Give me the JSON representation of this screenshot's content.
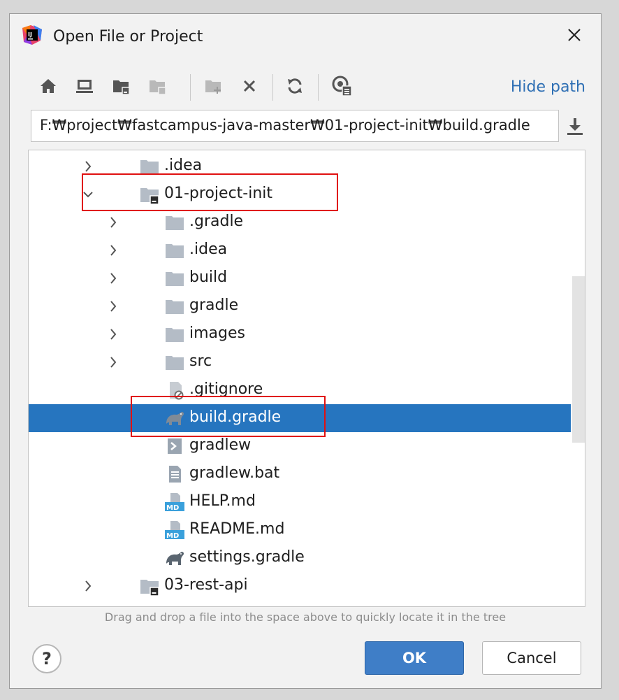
{
  "window": {
    "title": "Open File or Project"
  },
  "toolbar": {
    "buttons": [
      {
        "icon": "home-icon"
      },
      {
        "icon": "desktop-icon"
      },
      {
        "icon": "project-folder-icon"
      },
      {
        "icon": "module-folder-icon"
      },
      {
        "icon": "new-folder-icon"
      },
      {
        "icon": "delete-icon"
      },
      {
        "icon": "refresh-icon"
      },
      {
        "icon": "show-hidden-icon"
      }
    ],
    "hide_path_label": "Hide path"
  },
  "path": {
    "value": "F:₩project₩fastcampus-java-master₩01-project-init₩build.gradle"
  },
  "tree": {
    "items": [
      {
        "label": ".idea",
        "level": 0,
        "type": "folder",
        "expanded": false
      },
      {
        "label": "01-project-init",
        "level": 0,
        "type": "module-folder",
        "expanded": true
      },
      {
        "label": ".gradle",
        "level": 1,
        "type": "folder",
        "expanded": false
      },
      {
        "label": ".idea",
        "level": 1,
        "type": "folder",
        "expanded": false
      },
      {
        "label": "build",
        "level": 1,
        "type": "folder",
        "expanded": false
      },
      {
        "label": "gradle",
        "level": 1,
        "type": "folder",
        "expanded": false
      },
      {
        "label": "images",
        "level": 1,
        "type": "folder",
        "expanded": false
      },
      {
        "label": "src",
        "level": 1,
        "type": "folder",
        "expanded": false
      },
      {
        "label": ".gitignore",
        "level": 1,
        "type": "gitignore"
      },
      {
        "label": "build.gradle",
        "level": 1,
        "type": "gradle",
        "selected": true
      },
      {
        "label": "gradlew",
        "level": 1,
        "type": "script"
      },
      {
        "label": "gradlew.bat",
        "level": 1,
        "type": "text"
      },
      {
        "label": "HELP.md",
        "level": 1,
        "type": "md"
      },
      {
        "label": "README.md",
        "level": 1,
        "type": "md"
      },
      {
        "label": "settings.gradle",
        "level": 1,
        "type": "gradle"
      },
      {
        "label": "03-rest-api",
        "level": 0,
        "type": "module-folder",
        "expanded": false
      }
    ]
  },
  "hint": "Drag and drop a file into the space above to quickly locate it in the tree",
  "buttons": {
    "help": "?",
    "ok": "OK",
    "cancel": "Cancel"
  },
  "colors": {
    "selection": "#2675bf",
    "link": "#2e6fb4",
    "highlight_box": "#e01010",
    "ok_button": "#3f7ec7"
  }
}
